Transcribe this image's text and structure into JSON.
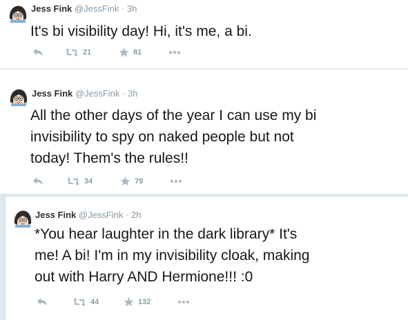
{
  "tweets": [
    {
      "author_name": "Jess Fink",
      "author_handle": "@JessFink",
      "separator": "·",
      "time": "3h",
      "lines": [
        "It's bi visibility day! Hi, it's me, a bi."
      ],
      "retweets": "21",
      "favorites": "81"
    },
    {
      "author_name": "Jess Fink",
      "author_handle": "@JessFink",
      "separator": "·",
      "time": "3h",
      "lines": [
        "All the other days of the year I can use my bi",
        "invisibility to spy on naked people but not",
        "today! Them's the rules!!"
      ],
      "retweets": "34",
      "favorites": "79"
    },
    {
      "author_name": "Jess Fink",
      "author_handle": "@JessFink",
      "separator": "·",
      "time": "2h",
      "lines": [
        "*You hear laughter in the dark library* It's",
        "me! A bi! I'm in my invisibility cloak, making",
        "out with Harry AND Hermione!!! :0"
      ],
      "retweets": "44",
      "favorites": "132"
    }
  ],
  "icons": {
    "reply": "reply-arrow",
    "retweet": "retweet-arrows",
    "favorite": "star",
    "more": "ellipsis"
  },
  "colors": {
    "action_gray": "#aab8c2",
    "meta_gray": "#8899a6",
    "text": "#14171a"
  }
}
